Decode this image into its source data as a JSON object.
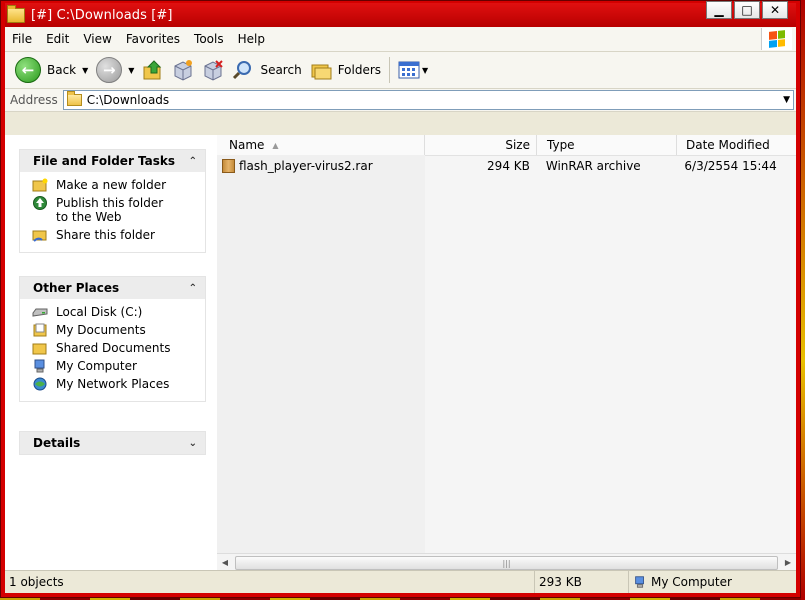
{
  "window": {
    "title": "[#] C:\\Downloads [#]",
    "min": "▁",
    "max": "□",
    "close": "✕"
  },
  "menu": [
    "File",
    "Edit",
    "View",
    "Favorites",
    "Tools",
    "Help"
  ],
  "toolbar": {
    "back": "Back",
    "search": "Search",
    "folders": "Folders"
  },
  "address": {
    "label": "Address",
    "value": "C:\\Downloads"
  },
  "taskpane": {
    "file_tasks": {
      "title": "File and Folder Tasks",
      "items": [
        "Make a new folder",
        "Publish this folder to the Web",
        "Share this folder"
      ]
    },
    "other_places": {
      "title": "Other Places",
      "items": [
        "Local Disk (C:)",
        "My Documents",
        "Shared Documents",
        "My Computer",
        "My Network Places"
      ]
    },
    "details": {
      "title": "Details"
    }
  },
  "columns": {
    "name": "Name",
    "size": "Size",
    "type": "Type",
    "modified": "Date Modified"
  },
  "files": [
    {
      "name": "flash_player-virus2.rar",
      "size": "294 KB",
      "type": "WinRAR archive",
      "modified": "6/3/2554 15:44"
    }
  ],
  "status": {
    "objects": "1 objects",
    "size": "293 KB",
    "location": "My Computer"
  },
  "colors": {
    "titlebar": "#d40000",
    "chrome": "#ece9d8"
  }
}
